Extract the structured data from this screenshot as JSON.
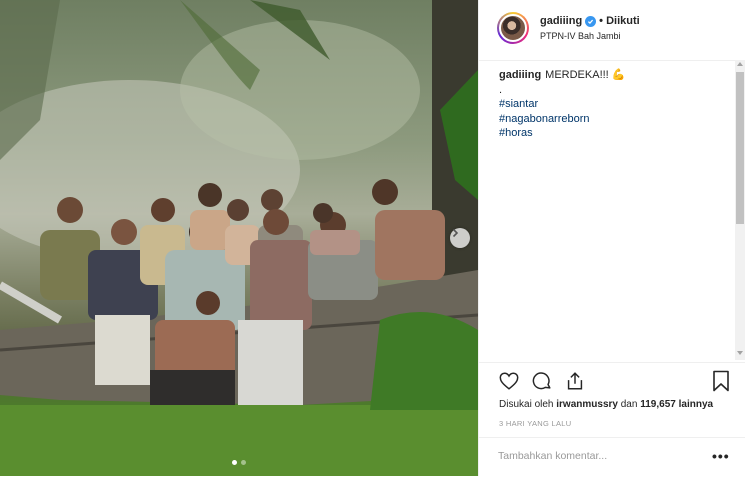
{
  "post": {
    "username": "gadiiing",
    "verified": true,
    "follow_text": "• Diikuti",
    "location": "PTPN-IV Bah Jambi",
    "caption": {
      "username": "gadiiing",
      "text": "MERDEKA!!!",
      "emoji": "💪",
      "separator": ".",
      "hashtags": [
        "#siantar",
        "#nagabonarreborn",
        "#horas"
      ]
    },
    "likes": {
      "prefix": "Disukai oleh",
      "liked_by": "irwanmussry",
      "middle": "dan",
      "count": "119,657",
      "suffix": "lainnya"
    },
    "timestamp": "3 HARI YANG LALU",
    "comment_placeholder": "Tambahkan komentar...",
    "more_label": "•••"
  },
  "carousel": {
    "slides": 2,
    "active_index": 0
  },
  "colors": {
    "text": "#262626",
    "muted": "#999999",
    "hashtag": "#003569",
    "verified": "#3897f0",
    "border": "#efefef"
  },
  "icons": [
    "heart-icon",
    "comment-icon",
    "share-icon",
    "bookmark-icon",
    "chevron-right-icon",
    "verified-badge-icon"
  ]
}
